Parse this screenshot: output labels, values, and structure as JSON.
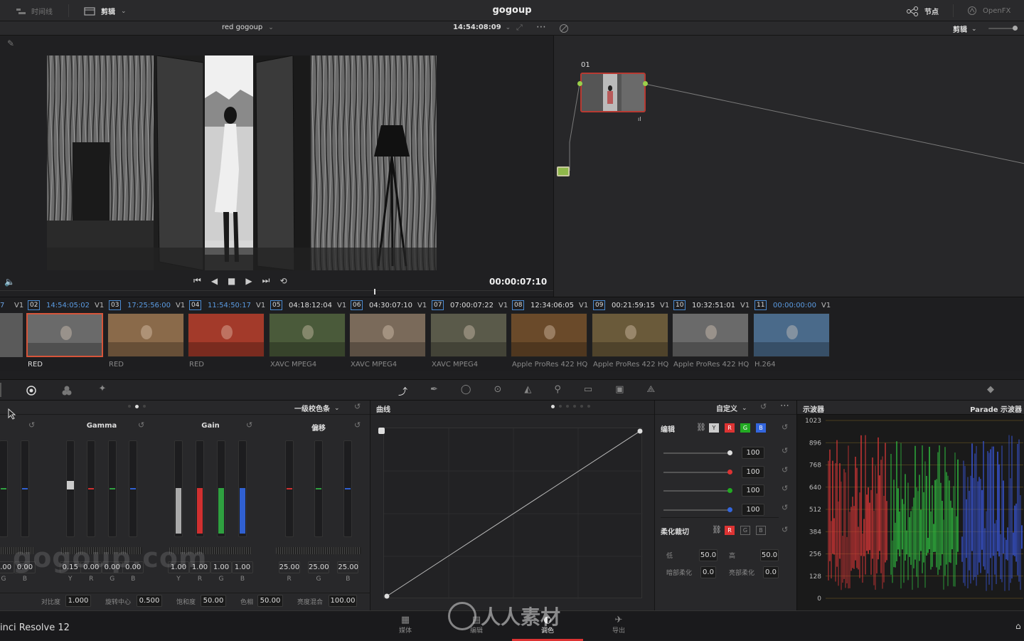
{
  "topbar": {
    "timeline_label": "时间线",
    "edit_label": "剪辑",
    "project_title": "gogoup",
    "nodes_label": "节点",
    "openfx_label": "OpenFX"
  },
  "viewer": {
    "clip_name": "red gogoup",
    "timecode_top": "14:54:08:09",
    "timecode_current": "00:00:07:10"
  },
  "node_editor": {
    "mode_label": "剪辑",
    "node_id": "01"
  },
  "clips": [
    {
      "index": "02",
      "timecode": "14:54:05:02",
      "track": "V1",
      "codec": "RED",
      "active": true,
      "thumb_color": "#6a6a6a"
    },
    {
      "index": "03",
      "timecode": "17:25:56:00",
      "track": "V1",
      "codec": "RED",
      "active": false,
      "thumb_color": "#8a6a4a"
    },
    {
      "index": "04",
      "timecode": "11:54:50:17",
      "track": "V1",
      "codec": "RED",
      "active": false,
      "thumb_color": "#a33a2a"
    },
    {
      "index": "05",
      "timecode": "04:18:12:04",
      "track": "V1",
      "codec": "XAVC MPEG4",
      "active": false,
      "thumb_color": "#4a5a3a"
    },
    {
      "index": "06",
      "timecode": "04:30:07:10",
      "track": "V1",
      "codec": "XAVC MPEG4",
      "active": false,
      "thumb_color": "#7a6a5a"
    },
    {
      "index": "07",
      "timecode": "07:00:07:22",
      "track": "V1",
      "codec": "XAVC MPEG4",
      "active": false,
      "thumb_color": "#5a5a4a"
    },
    {
      "index": "08",
      "timecode": "12:34:06:05",
      "track": "V1",
      "codec": "Apple ProRes 422 HQ",
      "active": false,
      "thumb_color": "#6a4a2a"
    },
    {
      "index": "09",
      "timecode": "00:21:59:15",
      "track": "V1",
      "codec": "Apple ProRes 422 HQ",
      "active": false,
      "thumb_color": "#6a5a3a"
    },
    {
      "index": "10",
      "timecode": "10:32:51:01",
      "track": "V1",
      "codec": "Apple ProRes 422 HQ",
      "active": false,
      "thumb_color": "#6a6a6a"
    },
    {
      "index": "11",
      "timecode": "00:00:00:00",
      "track": "V1",
      "codec": "H.264",
      "active": false,
      "thumb_color": "#4a6a8a"
    }
  ],
  "clip_first_partial": {
    "index": "7",
    "track": "V1"
  },
  "color_wheels": {
    "mode_label": "一级校色条",
    "groups": [
      {
        "title": "",
        "values": [
          "0.00",
          "0.00"
        ],
        "channels": [
          "G",
          "B"
        ]
      },
      {
        "title": "Gamma",
        "values": [
          "0.15",
          "0.00",
          "0.00",
          "0.00"
        ],
        "channels": [
          "Y",
          "R",
          "G",
          "B"
        ]
      },
      {
        "title": "Gain",
        "values": [
          "1.00",
          "1.00",
          "1.00",
          "1.00"
        ],
        "channels": [
          "Y",
          "R",
          "G",
          "B"
        ]
      },
      {
        "title": "偏移",
        "values": [
          "25.00",
          "25.00",
          "25.00"
        ],
        "channels": [
          "R",
          "G",
          "B"
        ]
      }
    ],
    "bottom": {
      "contrast_label": "对比度",
      "contrast": "1.000",
      "pivot_label": "旋转中心",
      "pivot": "0.500",
      "sat_label": "饱和度",
      "sat": "50.00",
      "hue_label": "色相",
      "hue": "50.00",
      "lummix_label": "亮度混合",
      "lummix": "100.00"
    }
  },
  "curves": {
    "title": "曲线",
    "mode_label": "自定义"
  },
  "edit_panel": {
    "title": "编辑",
    "channels": [
      "Y",
      "R",
      "G",
      "B"
    ],
    "values": [
      "100",
      "100",
      "100",
      "100"
    ],
    "soft_clip_title": "柔化裁切",
    "low_label": "低",
    "low": "50.0",
    "high_label": "高",
    "high": "50.0",
    "low_soft_label": "暗部柔化",
    "low_soft": "0.0",
    "high_soft_label": "亮部柔化",
    "high_soft": "0.0"
  },
  "scope": {
    "title": "示波器",
    "mode_label": "Parade 示波器",
    "ticks": [
      "1023",
      "896",
      "768",
      "640",
      "512",
      "384",
      "256",
      "128",
      "0"
    ]
  },
  "bottom_nav": {
    "app_name": "inci Resolve 12",
    "tabs": [
      "媒体",
      "编辑",
      "调色",
      "导出"
    ],
    "active_tab": "调色"
  },
  "watermark": {
    "text": "gogoup.com",
    "logo_text": "人人素材"
  }
}
